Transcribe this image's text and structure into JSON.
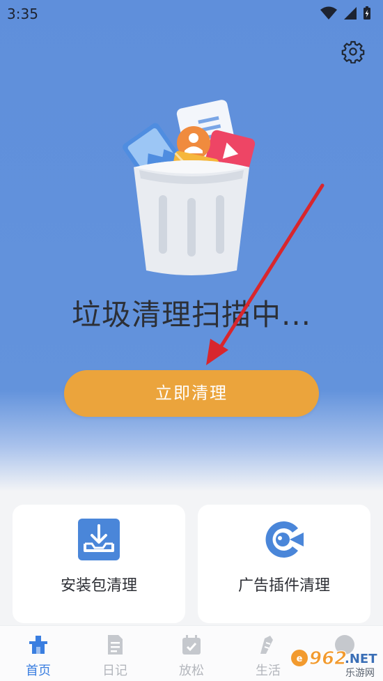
{
  "status_bar": {
    "time": "3:35"
  },
  "header": {
    "settings_icon": "gear-icon"
  },
  "scan": {
    "status_text": "垃圾清理扫描中..."
  },
  "clean_button": {
    "label": "立即清理",
    "color": "#eba43c"
  },
  "features": [
    {
      "label": "安装包清理",
      "icon": "download-tray-icon"
    },
    {
      "label": "广告插件清理",
      "icon": "ad-plugin-logo-icon"
    }
  ],
  "nav": {
    "items": [
      {
        "label": "首页",
        "icon": "home-icon",
        "active": true
      },
      {
        "label": "日记",
        "icon": "document-icon",
        "active": false
      },
      {
        "label": "放松",
        "icon": "calendar-check-icon",
        "active": false
      },
      {
        "label": "生活",
        "icon": "shoe-icon",
        "active": false
      },
      {
        "label": "",
        "icon": "smiley-icon",
        "active": false
      }
    ]
  },
  "watermark": {
    "number": "962",
    "suffix": ".NET",
    "caption": "乐游网"
  },
  "colors": {
    "background": "#6393dc",
    "accent": "#eba43c",
    "active_tab": "#3a7ee0",
    "arrow": "#d8262d"
  }
}
